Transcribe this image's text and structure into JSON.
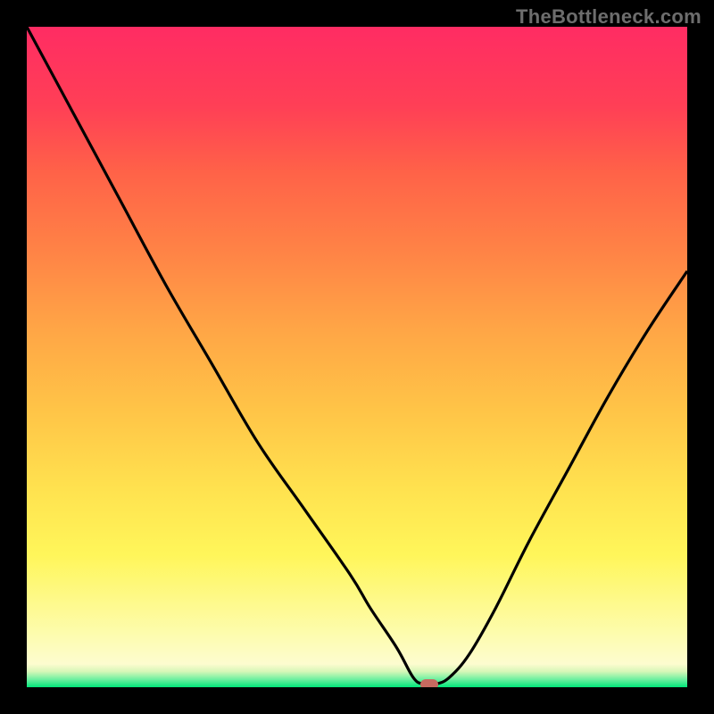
{
  "watermark": "TheBottleneck.com",
  "colors": {
    "curve": "#000000",
    "marker": "#c66a60",
    "background": "#000000",
    "gradient_top": "#ff2c63",
    "gradient_bottom": "#00e77a"
  },
  "chart_data": {
    "type": "line",
    "title": "",
    "xlabel": "",
    "ylabel": "",
    "xlim": [
      0,
      100
    ],
    "ylim": [
      0,
      100
    ],
    "grid": false,
    "series": [
      {
        "name": "bottleneck-curve",
        "x": [
          0,
          7,
          14,
          21,
          28,
          35,
          42,
          49,
          52,
          56,
          58.5,
          60,
          62,
          64,
          67,
          71,
          76,
          82,
          88,
          94,
          100
        ],
        "values": [
          100,
          87,
          74,
          61,
          49,
          37,
          27,
          17,
          12,
          6,
          1.5,
          0.5,
          0.5,
          1.5,
          5,
          12,
          22,
          33,
          44,
          54,
          63
        ]
      }
    ],
    "annotations": [
      {
        "name": "bottom-marker",
        "x": 61,
        "y": 0.4
      }
    ]
  }
}
